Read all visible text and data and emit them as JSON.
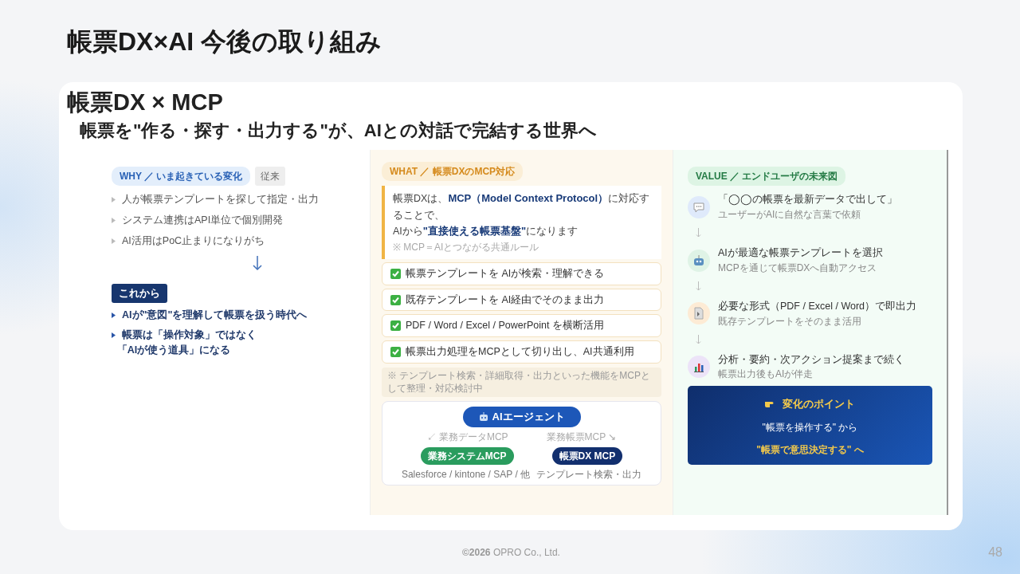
{
  "slide": {
    "title": "帳票DX×AI 今後の取り組み"
  },
  "card": {
    "heading": "帳票DX × MCP",
    "subheading": "帳票を\"作る・探す・出力する\"が、AIとの対話で完結する世界へ"
  },
  "why": {
    "tag": "WHY ／ いま起きている変化",
    "badge": "従来",
    "items": [
      "人が帳票テンプレートを探して指定・出力",
      "システム連携はAPI単位で個別開発",
      "AI活用はPoC止まりになりがち"
    ],
    "next_label": "これから",
    "next_items": [
      {
        "lines": [
          "AIが\"意図\"を理解して帳票を扱う時代へ"
        ]
      },
      {
        "lines": [
          "帳票は「操作対象」ではなく",
          "「AIが使う道具」になる"
        ]
      }
    ]
  },
  "what": {
    "tag": "WHAT ／ 帳票DXのMCP対応",
    "intro": "帳票DXは、**MCP（Model Context Protocol）**に対応することで、\nAIから**\"直接使える帳票基盤\"**になります",
    "note": "※ MCP＝AIとつながる共通ルール",
    "checks": [
      {
        "text": "帳票テンプレートを AIが検索・理解できる",
        "checked": true
      },
      {
        "text": "既存テンプレートを AI経由でそのまま出力",
        "checked": true
      },
      {
        "text": "PDF / Word / Excel / PowerPoint を横断活用",
        "checked": true
      },
      {
        "text": "帳票出力処理をMCPとして切り出し、AI共通利用",
        "checked": true
      }
    ],
    "footnote": "※ テンプレート検索・詳細取得・出力といった機能をMCPとして整理・対応検討中",
    "diagram": {
      "agent": "AIエージェント",
      "left_label": "↙ 業務データMCP",
      "right_label": "業務帳票MCP ↘",
      "left_node": "業務システムMCP",
      "right_node": "帳票DX MCP",
      "left_caption": "Salesforce / kintone / SAP / 他",
      "right_caption": "テンプレート検索・出力"
    }
  },
  "value": {
    "tag": "VALUE ／ エンドユーザの未来図",
    "steps": [
      {
        "kind": "chat",
        "title": "「◯◯の帳票を最新データで出して」",
        "caption": "ユーザーがAIに自然な言葉で依頼"
      },
      {
        "kind": "robot",
        "title": "AIが最適な帳票テンプレートを選択",
        "caption": "MCPを通じて帳票DXへ自動アクセス"
      },
      {
        "kind": "document",
        "title": "必要な形式（PDF / Excel / Word）で即出力",
        "caption": "既存テンプレートをそのまま活用"
      },
      {
        "kind": "chart",
        "title": "分析・要約・次アクション提案まで続く",
        "caption": "帳票出力後もAIが伴走"
      }
    ],
    "point": {
      "title": "変化のポイント",
      "line1": "\"帳票を操作する\" から",
      "line2": "\"帳票で意思決定する\" へ"
    }
  },
  "footer": {
    "copyright": "**©2026** OPRO Co., Ltd.",
    "page": "48"
  }
}
